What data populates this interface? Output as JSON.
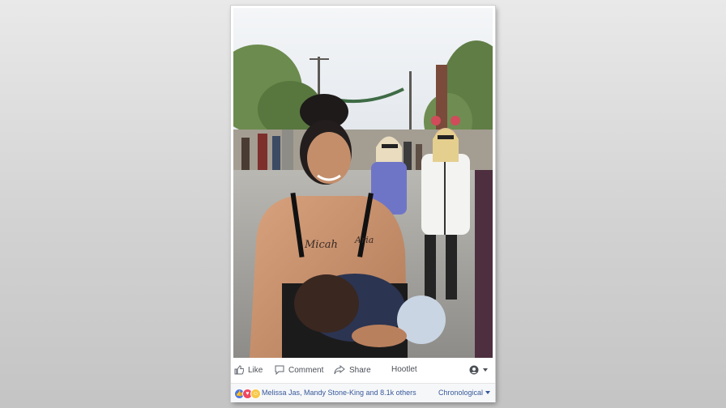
{
  "post": {
    "photo_alt": "Photo of a woman breastfeeding a child at a theme park",
    "tattoo_left": "Micah",
    "tattoo_right": "Aria"
  },
  "actions": {
    "like": "Like",
    "comment": "Comment",
    "share": "Share",
    "hootlet": "Hootlet"
  },
  "reactions": {
    "summary": "Melissa Jas, Mandy Stone-King and 8.1k others",
    "sort_label": "Chronological",
    "icons": [
      "like-icon",
      "love-icon",
      "haha-icon"
    ]
  },
  "colors": {
    "link": "#365899",
    "like_blue": "#4a76e8",
    "love_red": "#f0485f",
    "haha_yellow": "#f7c84a"
  }
}
